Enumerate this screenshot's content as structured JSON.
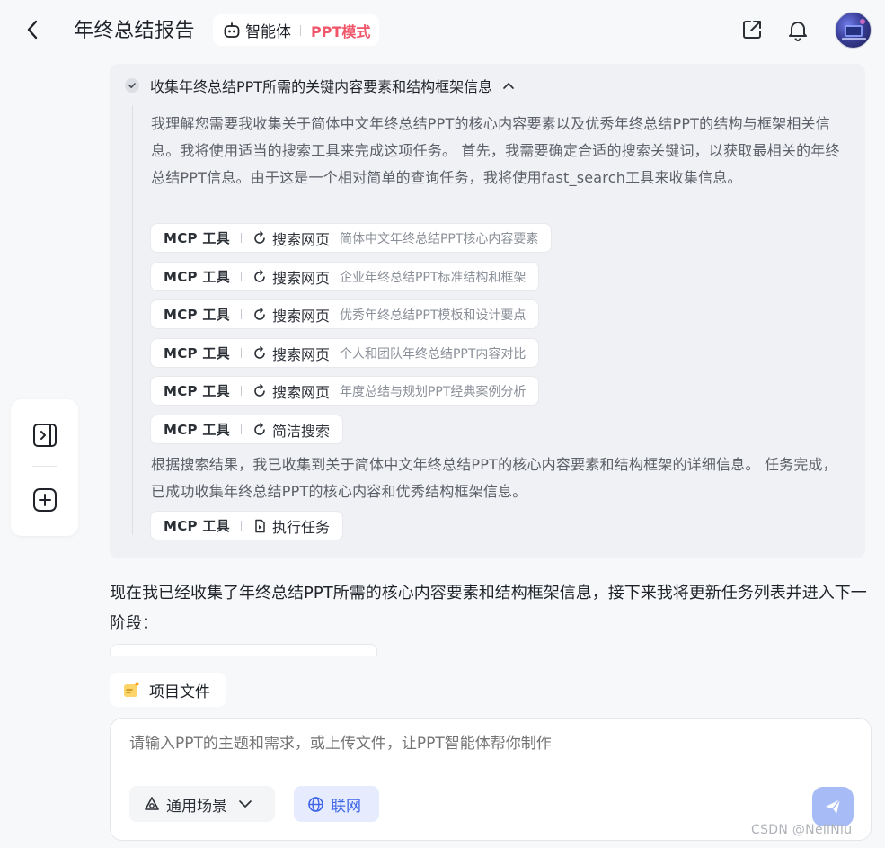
{
  "header": {
    "title": "年终总结报告",
    "agent_label": "智能体",
    "mode_label": "PPT模式",
    "back_icon": "chevron-left-icon",
    "share_icon": "external-link-icon",
    "bell_icon": "bell-icon"
  },
  "task": {
    "title": "收集年终总结PPT所需的关键内容要素和结构框架信息",
    "intro": "我理解您需要我收集关于简体中文年终总结PPT的核心内容要素以及优秀年终总结PPT的结构与框架相关信息。我将使用适当的搜索工具来完成这项任务。 首先，我需要确定合适的搜索关键词，以获取最相关的年终总结PPT信息。由于这是一个相对简单的查询任务，我将使用fast_search工具来收集信息。",
    "tool_calls": [
      {
        "kind": "MCP 工具",
        "tool": "搜索网页",
        "query": "简体中文年终总结PPT核心内容要素"
      },
      {
        "kind": "MCP 工具",
        "tool": "搜索网页",
        "query": "企业年终总结PPT标准结构和框架"
      },
      {
        "kind": "MCP 工具",
        "tool": "搜索网页",
        "query": "优秀年终总结PPT模板和设计要点"
      },
      {
        "kind": "MCP 工具",
        "tool": "搜索网页",
        "query": "个人和团队年终总结PPT内容对比"
      },
      {
        "kind": "MCP 工具",
        "tool": "搜索网页",
        "query": "年度总结与规划PPT经典案例分析"
      },
      {
        "kind": "MCP 工具",
        "tool": "简洁搜索",
        "query": ""
      }
    ],
    "result": "根据搜索结果，我已收集到关于简体中文年终总结PPT的核心内容要素和结构框架的详细信息。 任务完成，已成功收集年终总结PPT的核心内容和优秀结构框架信息。",
    "final_call": {
      "kind": "MCP 工具",
      "tool": "执行任务"
    }
  },
  "answer": "现在我已经收集了年终总结PPT所需的核心内容要素和结构框架信息，接下来我将更新任务列表并进入下一阶段：",
  "files_button": "项目文件",
  "composer": {
    "placeholder": "请输入PPT的主题和需求，或上传文件，让PPT智能体帮你制作",
    "scene_label": "通用场景",
    "web_label": "联网"
  },
  "watermark": "CSDN @NeilNiu",
  "colors": {
    "accent": "#3d63e8",
    "mode": "#f0566a",
    "send": "#a7bcf7"
  }
}
